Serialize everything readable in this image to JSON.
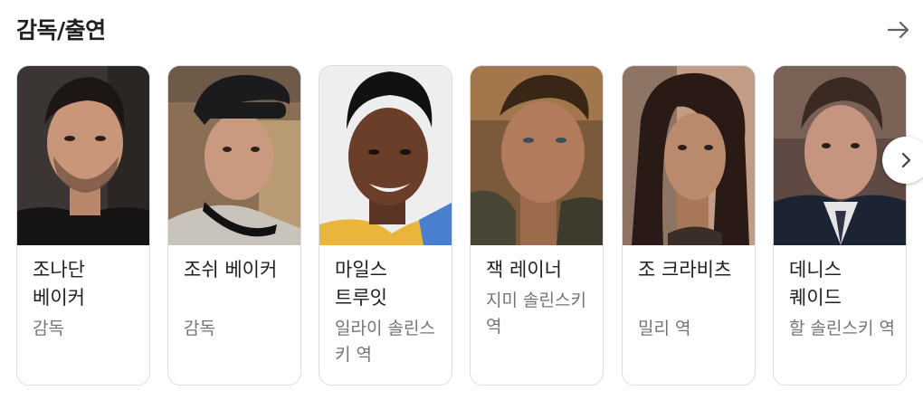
{
  "section": {
    "title": "감독/출연",
    "more_icon": "arrow-right-icon",
    "next_icon": "chevron-right-icon"
  },
  "people": [
    {
      "name": "조나단 베이커",
      "role": "감독"
    },
    {
      "name": "조쉬 베이커",
      "role": "감독"
    },
    {
      "name": "마일스 트루잇",
      "role": "일라이 솔린스키 역"
    },
    {
      "name": "잭 레이너",
      "role": "지미 솔린스키 역"
    },
    {
      "name": "조 크라비츠",
      "role": "밀리 역"
    },
    {
      "name": "데니스 퀘이드",
      "role": "할 솔린스키 역"
    }
  ],
  "colors": {
    "title": "#202124",
    "role": "#70757a",
    "border": "#dadce0"
  }
}
